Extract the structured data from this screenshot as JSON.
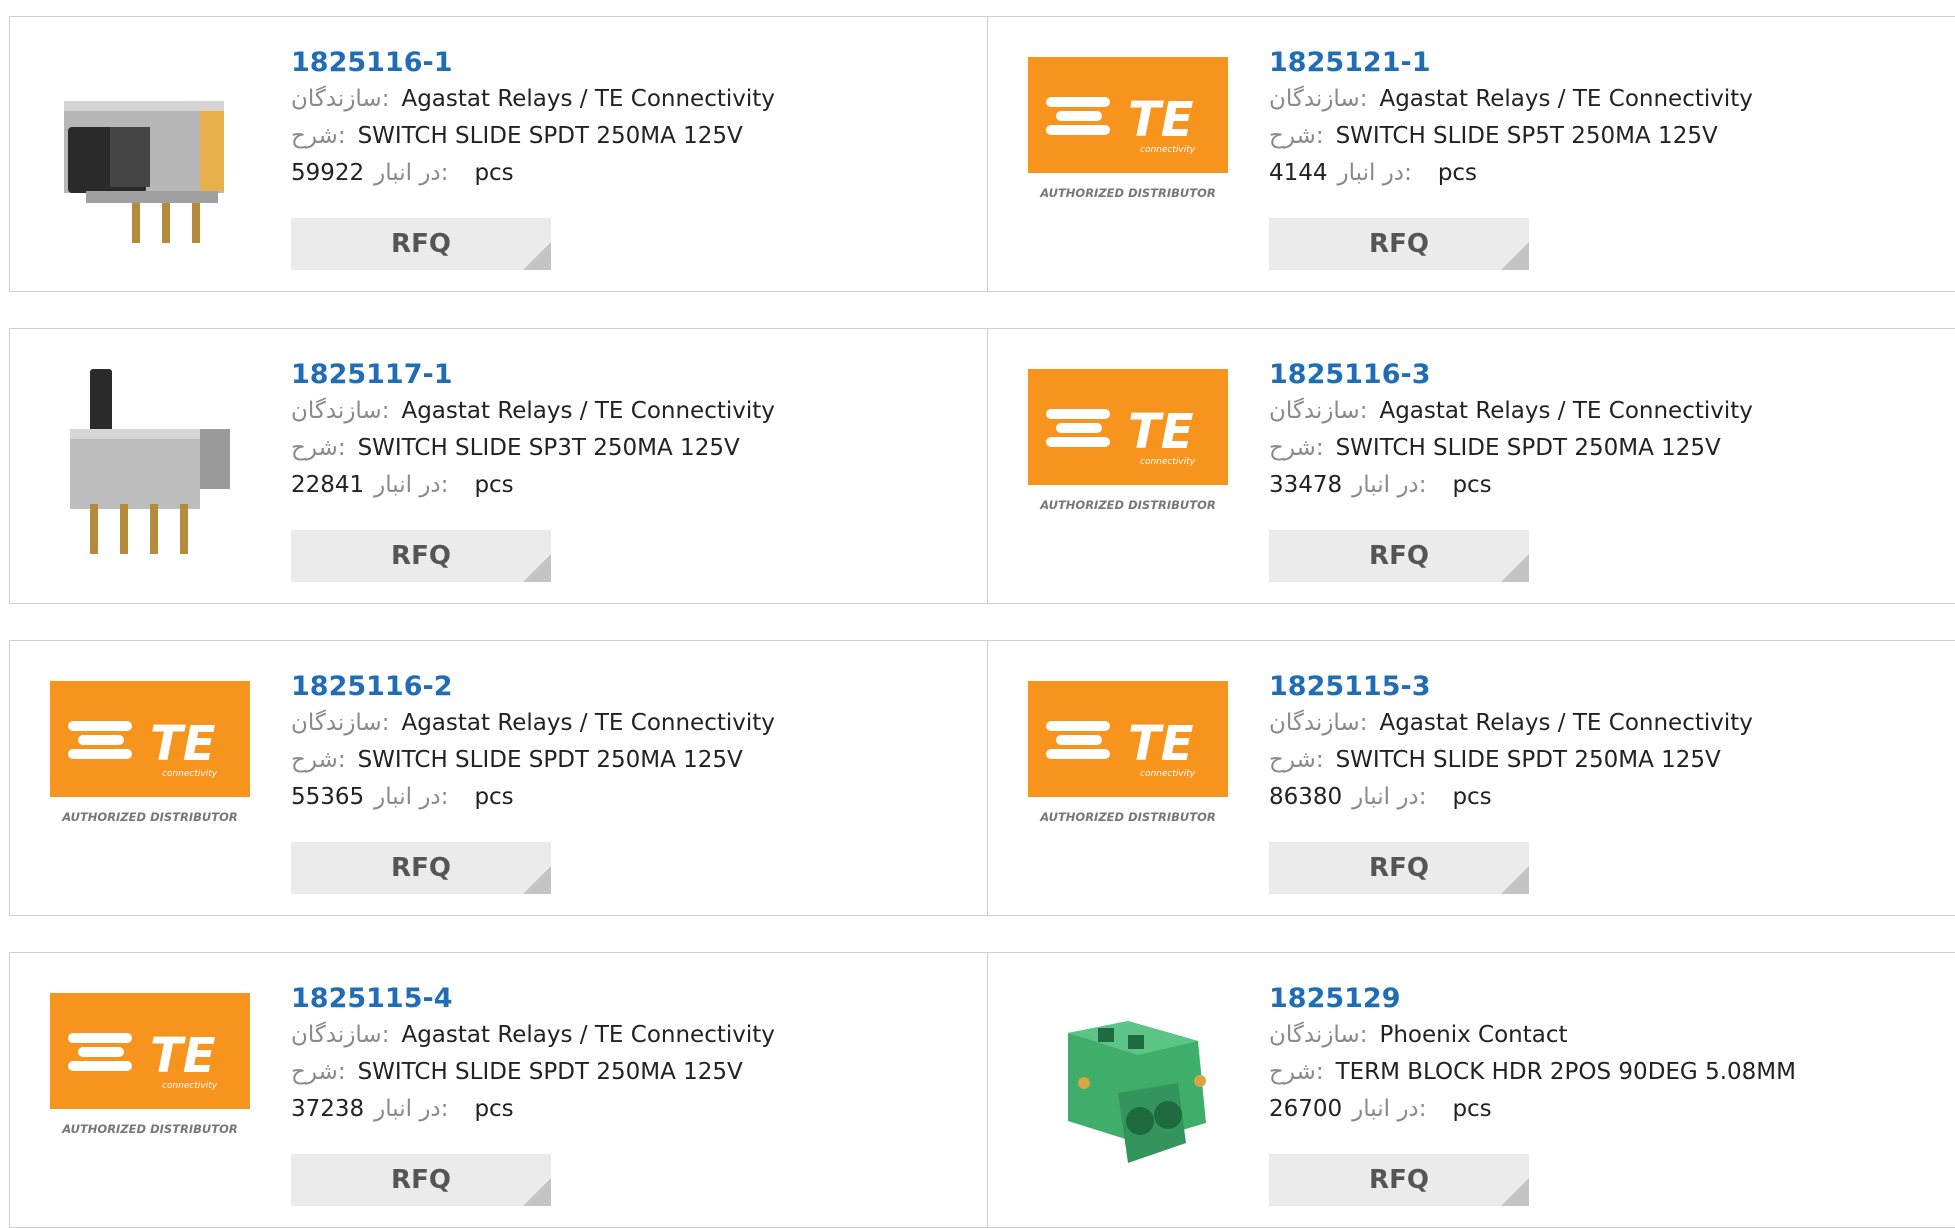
{
  "labels": {
    "manufacturer": "سازندگان:",
    "description": "شرح:",
    "stock": "در انبار:",
    "unit": "pcs",
    "rfq": "RFQ",
    "te_logo_sub": "connectivity",
    "te_logo_text": "TE",
    "te_badge": "AUTHORIZED DISTRIBUTOR"
  },
  "products": [
    {
      "part": "1825116-1",
      "manufacturer": "Agastat Relays / TE Connectivity",
      "description": "SWITCH SLIDE SPDT 250MA 125V",
      "stock": "59922",
      "image": "slide-switch-icon"
    },
    {
      "part": "1825121-1",
      "manufacturer": "Agastat Relays / TE Connectivity",
      "description": "SWITCH SLIDE SP5T 250MA 125V",
      "stock": "4144",
      "image": "te-logo-icon"
    },
    {
      "part": "1825117-1",
      "manufacturer": "Agastat Relays / TE Connectivity",
      "description": "SWITCH SLIDE SP3T 250MA 125V",
      "stock": "22841",
      "image": "slide-switch-vertical-icon"
    },
    {
      "part": "1825116-3",
      "manufacturer": "Agastat Relays / TE Connectivity",
      "description": "SWITCH SLIDE SPDT 250MA 125V",
      "stock": "33478",
      "image": "te-logo-icon"
    },
    {
      "part": "1825116-2",
      "manufacturer": "Agastat Relays / TE Connectivity",
      "description": "SWITCH SLIDE SPDT 250MA 125V",
      "stock": "55365",
      "image": "te-logo-icon"
    },
    {
      "part": "1825115-3",
      "manufacturer": "Agastat Relays / TE Connectivity",
      "description": "SWITCH SLIDE SPDT 250MA 125V",
      "stock": "86380",
      "image": "te-logo-icon"
    },
    {
      "part": "1825115-4",
      "manufacturer": "Agastat Relays / TE Connectivity",
      "description": "SWITCH SLIDE SPDT 250MA 125V",
      "stock": "37238",
      "image": "te-logo-icon"
    },
    {
      "part": "1825129",
      "manufacturer": "Phoenix Contact",
      "description": "TERM BLOCK HDR 2POS 90DEG 5.08MM",
      "stock": "26700",
      "image": "terminal-block-icon"
    }
  ],
  "colors": {
    "link": "#1f6db4",
    "te_orange": "#f7941d",
    "rfq_bg": "#ebebeb",
    "terminal_green": "#3fae6b"
  }
}
